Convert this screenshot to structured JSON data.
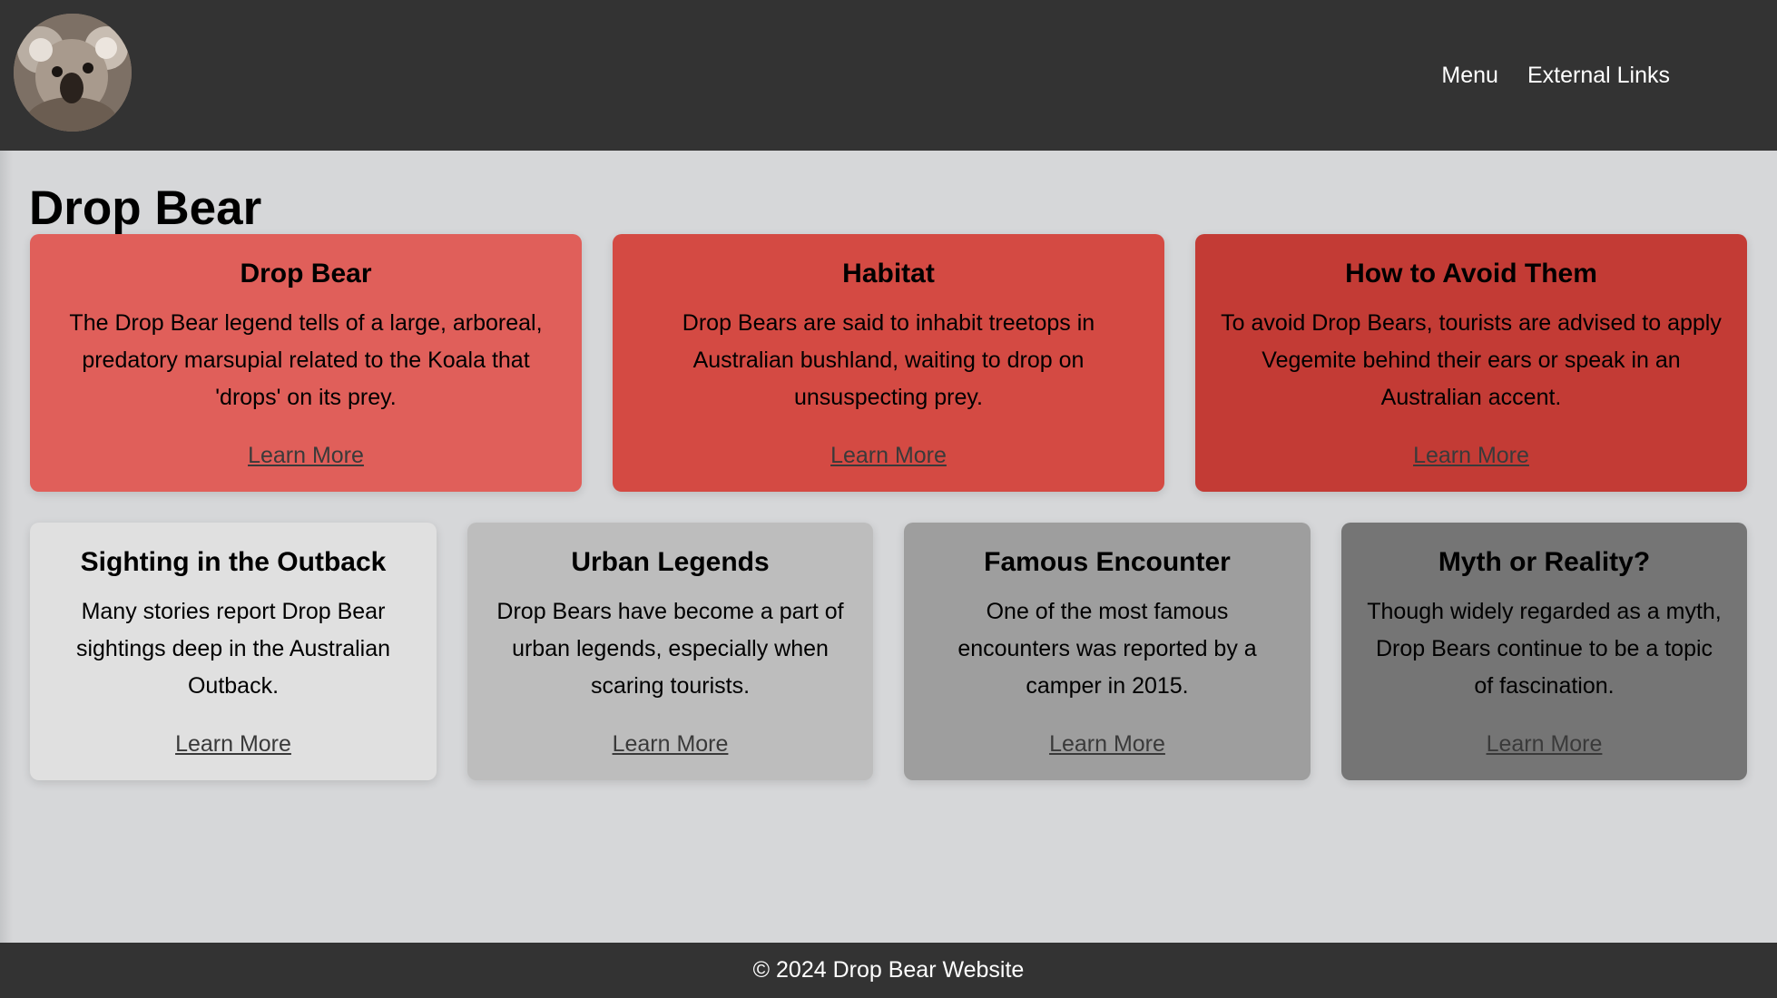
{
  "header": {
    "logo_icon": "koala-avatar-icon",
    "nav": [
      "Menu",
      "External Links"
    ]
  },
  "page_title": "Drop Bear",
  "top_cards": [
    {
      "title": "Drop Bear",
      "text": "The Drop Bear legend tells of a large, arboreal, predatory marsupial related to the Koala that 'drops' on its prey.",
      "link": "Learn More",
      "color": "#e05f5a"
    },
    {
      "title": "Habitat",
      "text": "Drop Bears are said to inhabit treetops in Australian bushland, waiting to drop on unsuspecting prey.",
      "link": "Learn More",
      "color": "#d44a43"
    },
    {
      "title": "How to Avoid Them",
      "text": "To avoid Drop Bears, tourists are advised to apply Vegemite behind their ears or speak in an Australian accent.",
      "link": "Learn More",
      "color": "#c33b35"
    }
  ],
  "bottom_cards": [
    {
      "title": "Sighting in the Outback",
      "text": "Many stories report Drop Bear sightings deep in the Australian Outback.",
      "link": "Learn More",
      "color": "#e0e0e0"
    },
    {
      "title": "Urban Legends",
      "text": "Drop Bears have become a part of urban legends, especially when scaring tourists.",
      "link": "Learn More",
      "color": "#bdbdbd"
    },
    {
      "title": "Famous Encounter",
      "text": "One of the most famous encounters was reported by a camper in 2015.",
      "link": "Learn More",
      "color": "#9e9e9e"
    },
    {
      "title": "Myth or Reality?",
      "text": "Though widely regarded as a myth, Drop Bears continue to be a topic of fascination.",
      "link": "Learn More",
      "color": "#757575"
    }
  ],
  "footer": "© 2024 Drop Bear Website"
}
